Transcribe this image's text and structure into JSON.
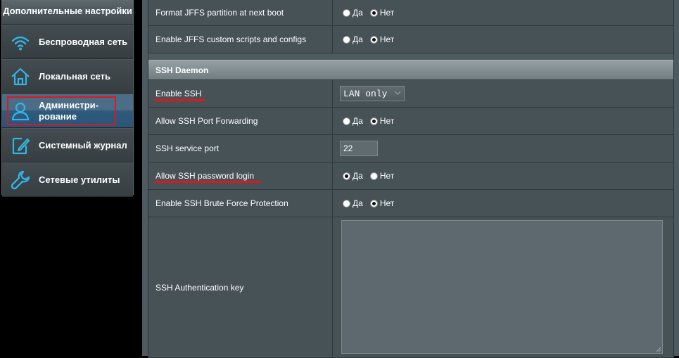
{
  "sidebar": {
    "header": "Дополнительные настройки",
    "items": [
      {
        "label": "Беспроводная сеть",
        "icon": "wifi-icon",
        "active": false
      },
      {
        "label": "Локальная сеть",
        "icon": "home-icon",
        "active": false
      },
      {
        "label": "Администри-рование",
        "icon": "admin-user-icon",
        "active": true
      },
      {
        "label": "Системный журнал",
        "icon": "log-edit-icon",
        "active": false
      },
      {
        "label": "Сетевые утилиты",
        "icon": "wrench-icon",
        "active": false
      }
    ]
  },
  "radio_labels": {
    "yes": "Да",
    "no": "Нет"
  },
  "jffs": {
    "format_label": "Format JFFS partition at next boot",
    "format_value": "no",
    "scripts_label": "Enable JFFS custom scripts and configs",
    "scripts_value": "no"
  },
  "ssh": {
    "section_title": "SSH Daemon",
    "enable_label": "Enable SSH",
    "enable_value": "LAN only",
    "port_forwarding_label": "Allow SSH Port Forwarding",
    "port_forwarding_value": "no",
    "port_label": "SSH service port",
    "port_value": "22",
    "password_login_label": "Allow SSH password login",
    "password_login_value": "yes",
    "brute_force_label": "Enable SSH Brute Force Protection",
    "brute_force_value": "no",
    "auth_key_label": "SSH Authentication key",
    "auth_key_value": ""
  },
  "colors": {
    "accent_highlight": "#e0161e",
    "icon_blue": "#33b4e8",
    "panel_bg": "#475257"
  }
}
